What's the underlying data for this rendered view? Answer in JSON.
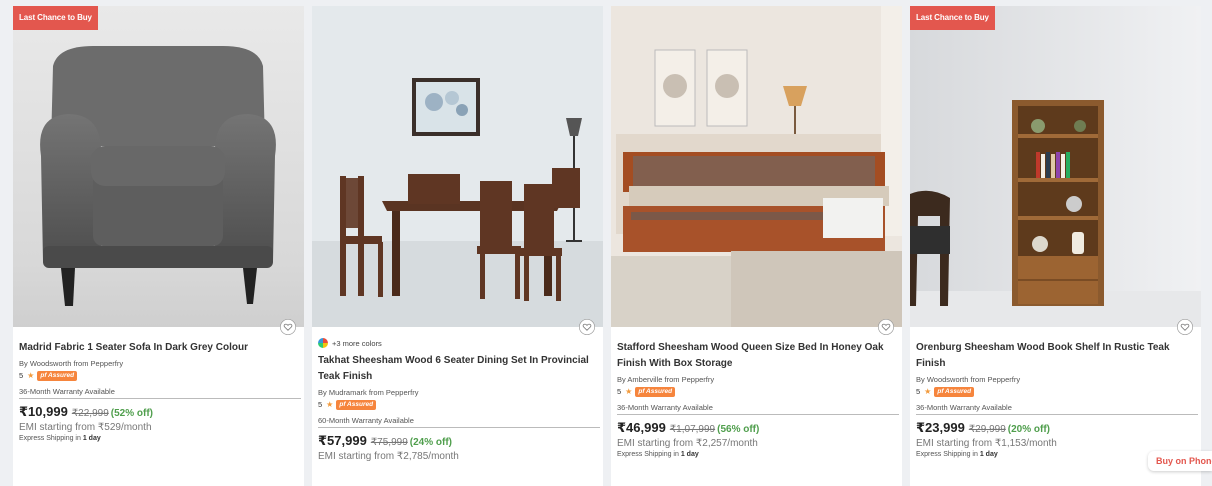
{
  "products": [
    {
      "badge": "Last Chance to Buy",
      "title": "Madrid Fabric 1 Seater Sofa In Dark Grey Colour",
      "by": "By Woodsworth from Pepperfry",
      "rating": "5",
      "assured": "pf Assured",
      "warranty": "36-Month Warranty Available",
      "price": "₹10,999",
      "mrp": "₹22,999",
      "off": "(52% off)",
      "emi": "EMI starting from ₹529/month",
      "shipping_label": "Express Shipping in",
      "shipping_time": "1 day"
    },
    {
      "colors": "+3 more colors",
      "title": "Takhat Sheesham Wood 6 Seater Dining Set In Provincial Teak Finish",
      "by": "By Mudramark from Pepperfry",
      "rating": "5",
      "assured": "pf Assured",
      "warranty": "60-Month Warranty Available",
      "price": "₹57,999",
      "mrp": "₹75,999",
      "off": "(24% off)",
      "emi": "EMI starting from ₹2,785/month"
    },
    {
      "title": "Stafford Sheesham Wood Queen Size Bed In Honey Oak Finish With Box Storage",
      "by": "By Amberville from Pepperfry",
      "rating": "5",
      "assured": "pf Assured",
      "warranty": "36-Month Warranty Available",
      "price": "₹46,999",
      "mrp": "₹1,07,999",
      "off": "(56% off)",
      "emi": "EMI starting from ₹2,257/month",
      "shipping_label": "Express Shipping in",
      "shipping_time": "1 day"
    },
    {
      "badge": "Last Chance to Buy",
      "title": "Orenburg Sheesham Wood Book Shelf In Rustic Teak Finish",
      "by": "By Woodsworth from Pepperfry",
      "rating": "5",
      "assured": "pf Assured",
      "warranty": "36-Month Warranty Available",
      "price": "₹23,999",
      "mrp": "₹29,999",
      "off": "(20% off)",
      "emi": "EMI starting from ₹1,153/month",
      "shipping_label": "Express Shipping in",
      "shipping_time": "1 day"
    }
  ],
  "buy_on_phone": "Buy on Phone",
  "colors": {
    "badge": "#e3574e",
    "assured": "#f6853d",
    "discount": "#4f9e4c",
    "star": "#f29a3c"
  }
}
